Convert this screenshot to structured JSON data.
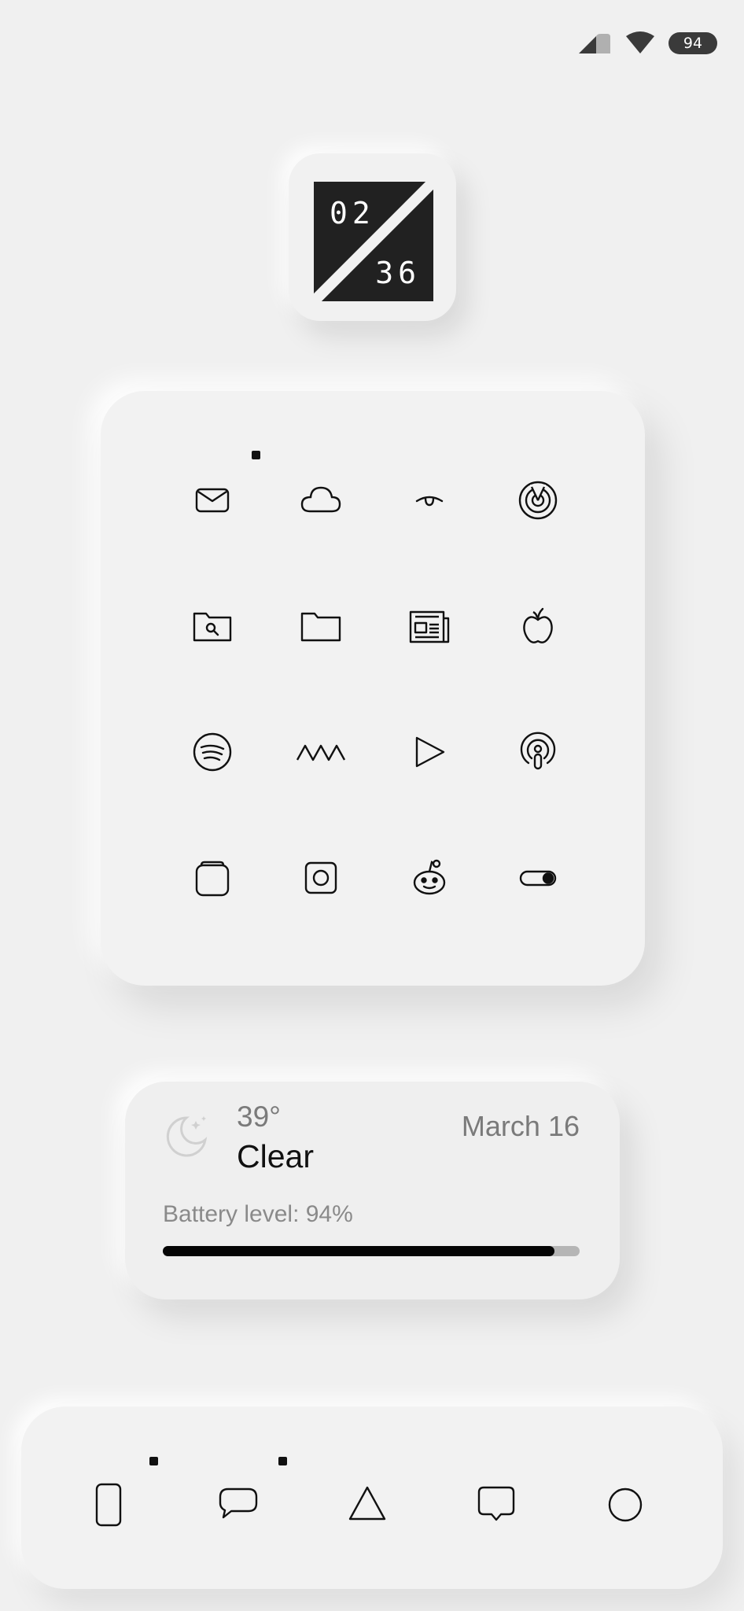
{
  "status_bar": {
    "battery_percent": "94"
  },
  "clock": {
    "hours": "02",
    "minutes": "36"
  },
  "apps": [
    {
      "icon": "mail-icon"
    },
    {
      "icon": "cloud-icon"
    },
    {
      "icon": "eye-icon"
    },
    {
      "icon": "radar-icon"
    },
    {
      "icon": "folder-search-icon"
    },
    {
      "icon": "folder-icon"
    },
    {
      "icon": "newspaper-icon"
    },
    {
      "icon": "apple-icon"
    },
    {
      "icon": "spotify-icon"
    },
    {
      "icon": "zigzag-icon"
    },
    {
      "icon": "play-icon"
    },
    {
      "icon": "podcasts-icon"
    },
    {
      "icon": "stacked-square-icon"
    },
    {
      "icon": "instagram-icon"
    },
    {
      "icon": "reddit-icon"
    },
    {
      "icon": "toggle-icon"
    }
  ],
  "weather": {
    "temperature": "39°",
    "condition": "Clear",
    "date": "March 16",
    "battery_label": "Battery level: 94%",
    "battery_level": 0.94
  },
  "dock": [
    {
      "icon": "phone-icon"
    },
    {
      "icon": "message-icon"
    },
    {
      "icon": "triangle-icon"
    },
    {
      "icon": "chat-icon"
    },
    {
      "icon": "circle-icon"
    }
  ]
}
